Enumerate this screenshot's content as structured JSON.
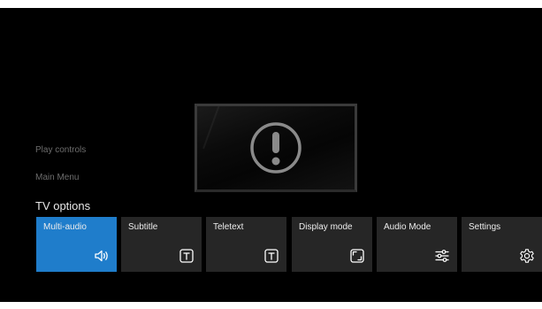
{
  "sidebar": {
    "play_controls": "Play controls",
    "main_menu": "Main Menu"
  },
  "panel": {
    "title": "TV options",
    "selected_index": 0,
    "options": [
      {
        "label": "Multi-audio",
        "icon": "speaker-icon"
      },
      {
        "label": "Subtitle",
        "icon": "text-box-icon"
      },
      {
        "label": "Teletext",
        "icon": "text-box-icon"
      },
      {
        "label": "Display mode",
        "icon": "aspect-ratio-icon"
      },
      {
        "label": "Audio Mode",
        "icon": "equalizer-icon"
      },
      {
        "label": "Settings",
        "icon": "gear-icon"
      }
    ]
  },
  "status": {
    "icon": "exclamation-circle-icon"
  },
  "colors": {
    "selected_tile": "#1f7dcb",
    "tile": "#262626",
    "background": "#000000"
  }
}
